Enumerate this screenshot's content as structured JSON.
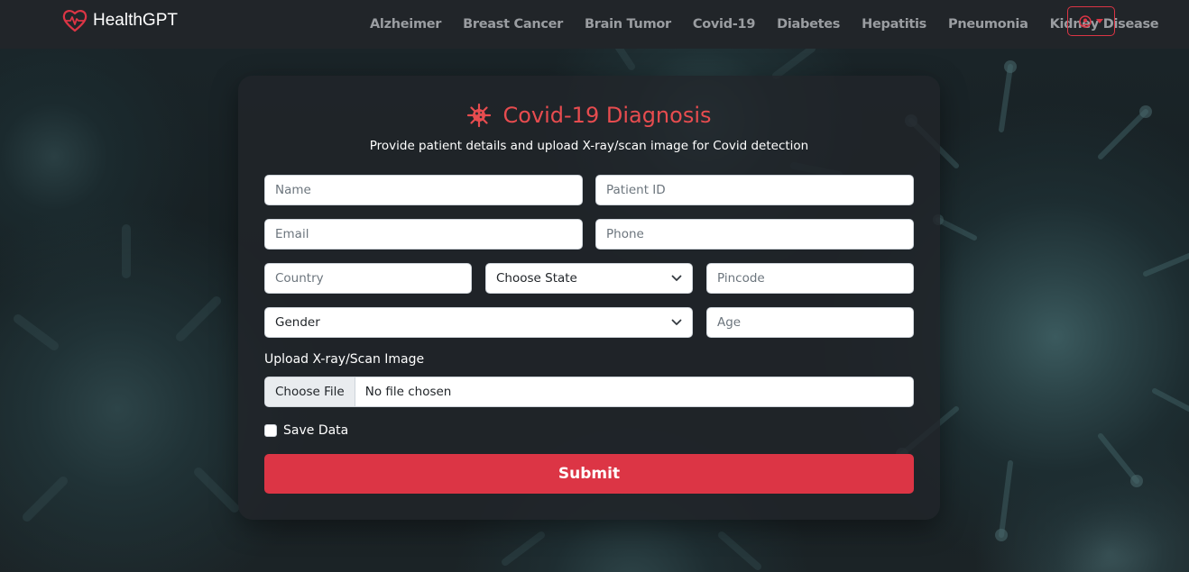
{
  "navbar": {
    "brand": "HealthGPT",
    "links": [
      {
        "label": "Alzheimer"
      },
      {
        "label": "Breast Cancer"
      },
      {
        "label": "Brain Tumor"
      },
      {
        "label": "Covid-19"
      },
      {
        "label": "Diabetes"
      },
      {
        "label": "Hepatitis"
      },
      {
        "label": "Pneumonia"
      },
      {
        "label": "Kidney Disease"
      }
    ],
    "user_icon": "user-circle-icon"
  },
  "form": {
    "title": "Covid-19 Diagnosis",
    "title_icon": "virus-icon",
    "subtitle": "Provide patient details and upload X-ray/scan image for Covid detection",
    "fields": {
      "name": {
        "placeholder": "Name",
        "value": ""
      },
      "patient_id": {
        "placeholder": "Patient ID",
        "value": ""
      },
      "email": {
        "placeholder": "Email",
        "value": ""
      },
      "phone": {
        "placeholder": "Phone",
        "value": ""
      },
      "country": {
        "placeholder": "Country",
        "value": ""
      },
      "state": {
        "selected": "Choose State"
      },
      "pincode": {
        "placeholder": "Pincode",
        "value": ""
      },
      "gender": {
        "selected": "Gender"
      },
      "age": {
        "placeholder": "Age",
        "value": ""
      }
    },
    "upload": {
      "label": "Upload X-ray/Scan Image",
      "button": "Choose File",
      "status": "No file chosen"
    },
    "save_data_label": "Save Data",
    "save_data_checked": false,
    "submit_label": "Submit"
  },
  "colors": {
    "accent": "#dc3545",
    "title": "#e74c4f",
    "navbar_bg": "#212529",
    "nav_link": "#9a9da1"
  }
}
